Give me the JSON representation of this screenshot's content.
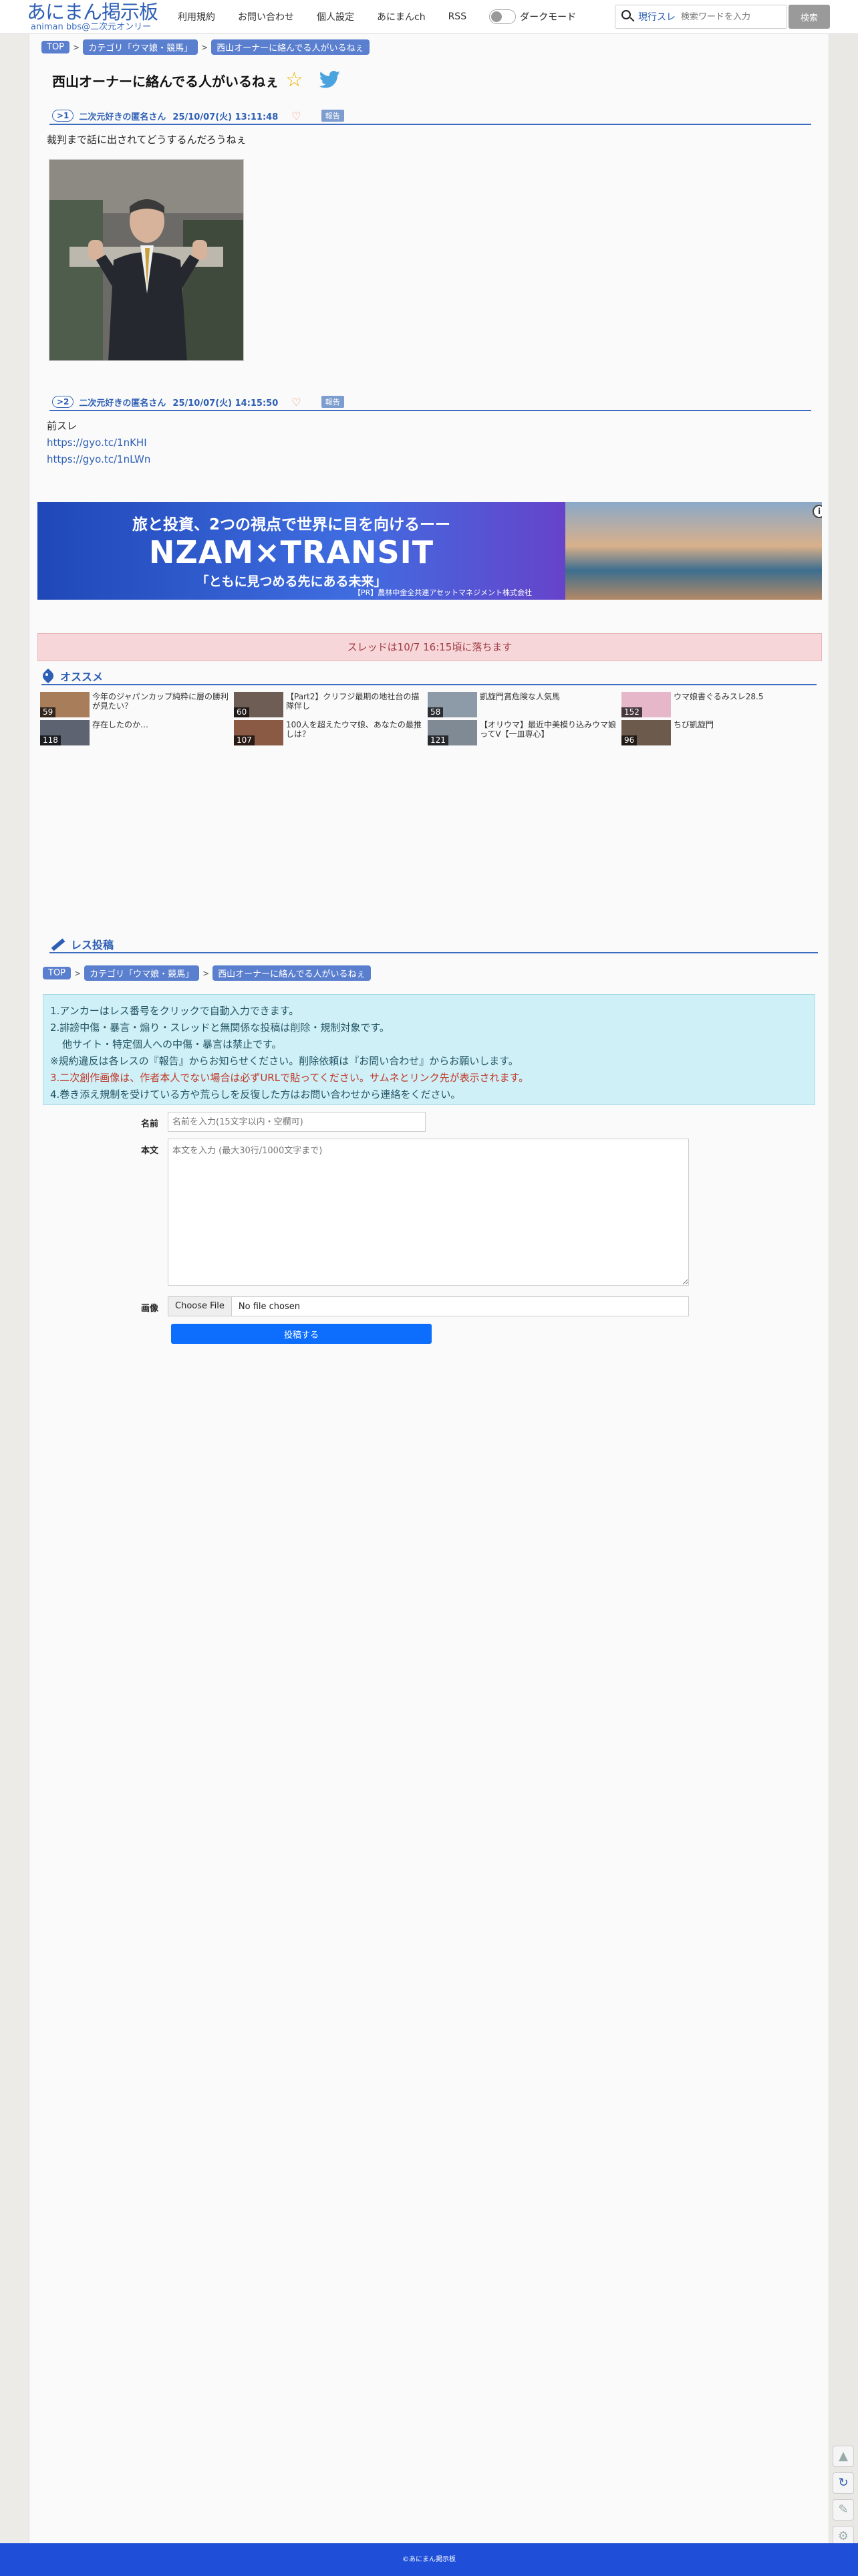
{
  "header": {
    "logo_main": "あにまん掲示板",
    "logo_sub": "animan bbs@二次元オンリー",
    "nav": [
      "利用規約",
      "お問い合わせ",
      "個人設定",
      "あにまんch",
      "RSS"
    ],
    "dark_mode_label": "ダークモード",
    "search_mode": "現行スレ",
    "search_placeholder": "検索ワードを入力",
    "search_button": "検索"
  },
  "breadcrumb": {
    "top": "TOP",
    "category": "カテゴリ「ウマ娘・競馬」",
    "thread": "西山オーナーに絡んでる人がいるねぇ"
  },
  "thread": {
    "title": "西山オーナーに絡んでる人がいるねぇ"
  },
  "posts": [
    {
      "num": ">1",
      "name": "二次元好きの匿名さん",
      "date": "25/10/07(火) 13:11:48",
      "report": "報告",
      "text": "裁判まで話に出されてどうするんだろうねぇ"
    },
    {
      "num": ">2",
      "name": "二次元好きの匿名さん",
      "date": "25/10/07(火) 14:15:50",
      "report": "報告",
      "text": "前スレ",
      "links": [
        "https://gyo.tc/1nKHI",
        "https://gyo.tc/1nLWn"
      ]
    }
  ],
  "ad": {
    "line1": "旅と投資、2つの視点で世界に目を向けるーー",
    "line2": "NZAM×TRANSIT",
    "line3": "「ともに見つめる先にある未来」",
    "line4": "【PR】農林中金全共連アセットマネジメント株式会社",
    "info": "i"
  },
  "notice": "スレッドは10/7 16:15頃に落ちます",
  "recommend": {
    "title": "オススメ",
    "items": [
      {
        "title": "今年のジャパンカップ純粋に層の勝利が見たい？",
        "count": "59"
      },
      {
        "title": "【Part2】クリフジ最期の地社台の描隊伴し",
        "count": "60"
      },
      {
        "title": "凱旋門賞危険な人気馬",
        "count": "58"
      },
      {
        "title": "ウマ娘書ぐるみスレ28.5",
        "count": "152"
      },
      {
        "title": "存在したのか…",
        "count": "118"
      },
      {
        "title": "100人を超えたウマ娘、あなたの最推しは？",
        "count": "107"
      },
      {
        "title": "【オリウマ】最近中美模り込みウマ娘ってV【一皿専心】",
        "count": "121"
      },
      {
        "title": "ちび凱旋門",
        "count": "96"
      }
    ]
  },
  "form": {
    "title": "レス投稿",
    "rules": [
      "1.アンカーはレス番号をクリックで自動入力できます。",
      "2.誹謗中傷・暴言・煽り・スレッドと無関係な投稿は削除・規制対象です。",
      "他サイト・特定個人への中傷・暴言は禁止です。",
      "※規約違反は各レスの『報告』からお知らせください。削除依頼は『お問い合わせ』からお願いします。",
      "3.二次創作画像は、作者本人でない場合は必ずURLで貼ってください。サムネとリンク先が表示されます。",
      "4.巻き添え規制を受けている方や荒らしを反復した方はお問い合わせから連絡をください。"
    ],
    "name_label": "名前",
    "name_placeholder": "名前を入力(15文字以内・空欄可)",
    "body_label": "本文",
    "body_placeholder": "本文を入力 (最大30行/1000文字まで)",
    "image_label": "画像",
    "file_button": "Choose File",
    "file_status": "No file chosen",
    "submit": "投稿する"
  },
  "footer": "©あにまん掲示板",
  "colors": {
    "accent": "#2d5fb5",
    "footer": "#1f4fd8",
    "notice_bg": "#f7d6d9",
    "rules_bg": "#cff0f6"
  }
}
